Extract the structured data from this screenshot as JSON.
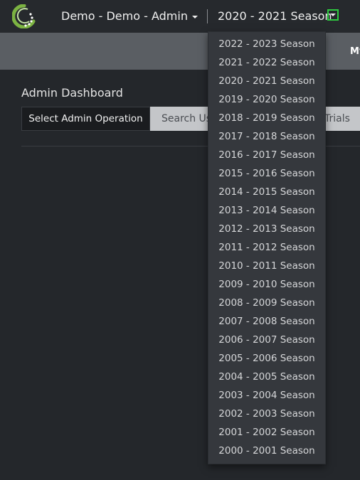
{
  "header": {
    "org_label": "Demo - Demo - Admin",
    "season_label": "2020 - 2021 Season",
    "logo_icon": "app-logo-icon",
    "toggle_icon": "caret-down-icon",
    "toggle_highlight_color": "#2ecc40"
  },
  "nav": {
    "partial_label": "My"
  },
  "main": {
    "title": "Admin Dashboard",
    "admin_button": "Select Admin Operation",
    "search_tab_partial": "Search Us",
    "trials_partial": "Trials"
  },
  "season_dropdown": {
    "items": [
      "2022 - 2023 Season",
      "2021 - 2022 Season",
      "2020 - 2021 Season",
      "2019 - 2020 Season",
      "2018 - 2019 Season",
      "2017 - 2018 Season",
      "2016 - 2017 Season",
      "2015 - 2016 Season",
      "2014 - 2015 Season",
      "2013 - 2014 Season",
      "2012 - 2013 Season",
      "2011 - 2012 Season",
      "2010 - 2011 Season",
      "2009 - 2010 Season",
      "2008 - 2009 Season",
      "2007 - 2008 Season",
      "2006 - 2007 Season",
      "2005 - 2006 Season",
      "2004 - 2005 Season",
      "2003 - 2004 Season",
      "2002 - 2003 Season",
      "2001 - 2002 Season",
      "2000 - 2001 Season"
    ]
  }
}
